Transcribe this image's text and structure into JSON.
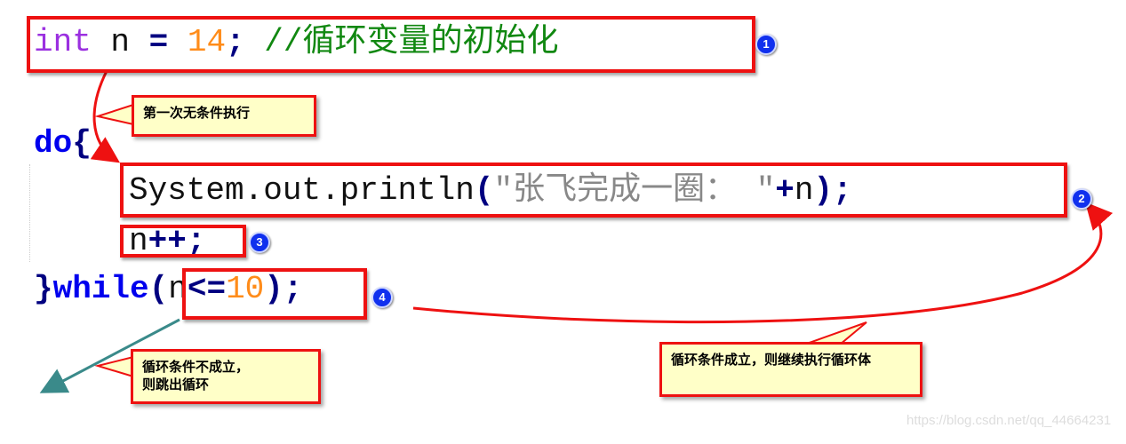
{
  "code": {
    "line1": {
      "type": "int",
      "var": " n ",
      "eq": "=",
      "num": " 14",
      "semi": ";",
      "comment": " //循环变量的初始化"
    },
    "line2": {
      "kw": "do",
      "brace": "{"
    },
    "line3": {
      "prefix": "System.out.println",
      "lp": "(",
      "str": "\"张飞完成一圈： \"",
      "plus": "+",
      "var": "n",
      "rp": ")",
      "semi": ";"
    },
    "line4": {
      "var": "n",
      "op": "++",
      "semi": ";"
    },
    "line5": {
      "brace": "}",
      "kw": "while",
      "lp": "(",
      "var": "n",
      "op": "<=",
      "num": "10",
      "rp": ")",
      "semi": ";"
    }
  },
  "badges": [
    "1",
    "2",
    "3",
    "4"
  ],
  "callouts": {
    "first": "第一次无条件执行",
    "exit_line1": "循环条件不成立，",
    "exit_line2": "则跳出循环",
    "continue": "循环条件成立，则继续执行循环体"
  },
  "watermark": "https://blog.csdn.net/qq_44664231",
  "colors": {
    "highlight": "#ee1111",
    "callout_bg": "#ffffc8",
    "badge": "#1030ee",
    "exit_arrow": "#3a8a8a"
  }
}
